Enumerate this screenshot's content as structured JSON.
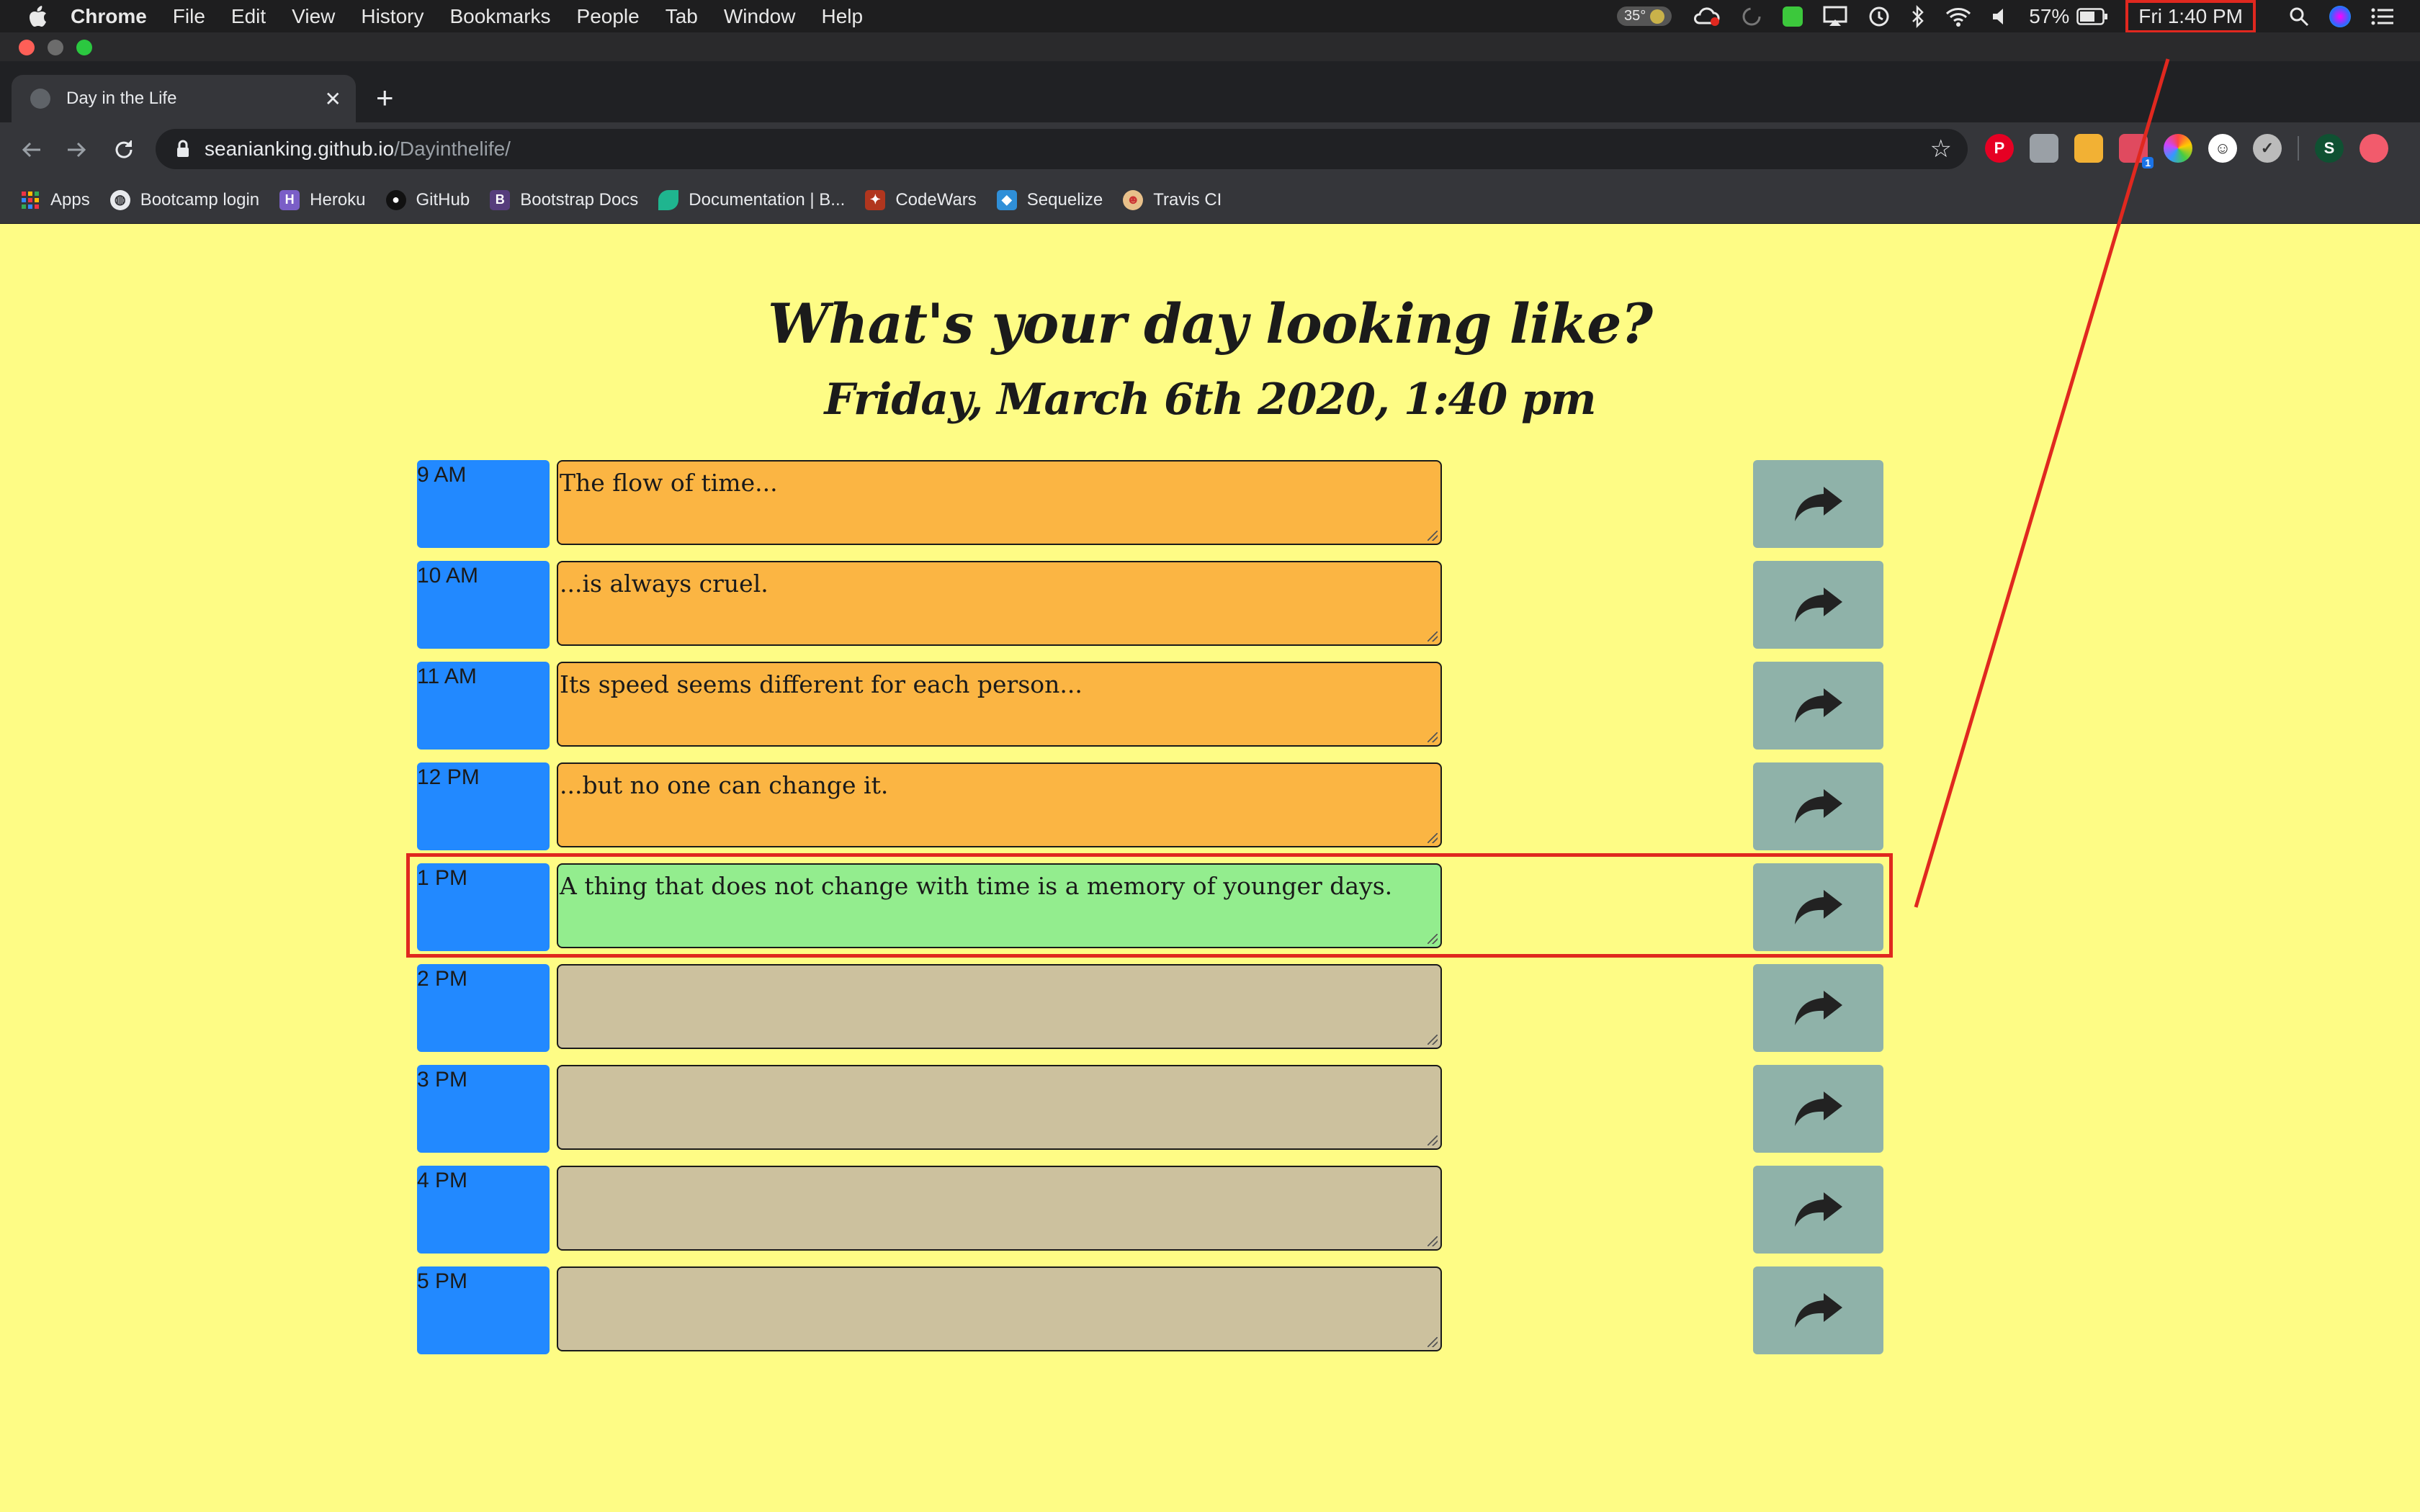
{
  "menubar": {
    "app_name": "Chrome",
    "menus": [
      "File",
      "Edit",
      "View",
      "History",
      "Bookmarks",
      "People",
      "Tab",
      "Window",
      "Help"
    ],
    "temperature": "35°",
    "battery": "57%",
    "clock": "Fri 1:40 PM",
    "user_initial": ""
  },
  "browser": {
    "tab_title": "Day in the Life",
    "url_host": "seanianking.github.io",
    "url_path": "/Dayinthelife/",
    "extension_badge": "1",
    "profile_initial": "S",
    "bookmarks": [
      {
        "label": "Apps",
        "icon": "apps-grid-icon"
      },
      {
        "label": "Bootcamp login",
        "icon": "globe-icon"
      },
      {
        "label": "Heroku",
        "icon": "heroku-icon"
      },
      {
        "label": "GitHub",
        "icon": "github-icon"
      },
      {
        "label": "Bootstrap Docs",
        "icon": "bootstrap-icon"
      },
      {
        "label": "Documentation | B...",
        "icon": "docs-icon"
      },
      {
        "label": "CodeWars",
        "icon": "codewars-icon"
      },
      {
        "label": "Sequelize",
        "icon": "sequelize-icon"
      },
      {
        "label": "Travis CI",
        "icon": "travis-icon"
      }
    ]
  },
  "page": {
    "title": "What's your day looking like?",
    "current_day": "Friday, March 6th 2020, 1:40 pm"
  },
  "schedule": [
    {
      "hour": "9 AM",
      "text": "The flow of time...",
      "state": "past"
    },
    {
      "hour": "10 AM",
      "text": "...is always cruel.",
      "state": "past"
    },
    {
      "hour": "11 AM",
      "text": "Its speed seems different for each person...",
      "state": "past"
    },
    {
      "hour": "12 PM",
      "text": "...but no one can change it.",
      "state": "past"
    },
    {
      "hour": "1 PM",
      "text": "A thing that does not change with time is a memory of younger days.",
      "state": "present"
    },
    {
      "hour": "2 PM",
      "text": "",
      "state": "future"
    },
    {
      "hour": "3 PM",
      "text": "",
      "state": "future"
    },
    {
      "hour": "4 PM",
      "text": "",
      "state": "future"
    },
    {
      "hour": "5 PM",
      "text": "",
      "state": "future"
    }
  ],
  "colors": {
    "page_background": "#fefc85",
    "hour_block": "#2289ff",
    "past": "#fbb543",
    "present": "#93ed8e",
    "future": "#ccc19e",
    "save_button": "#8fb2a9",
    "annotation": "#e0281f"
  }
}
